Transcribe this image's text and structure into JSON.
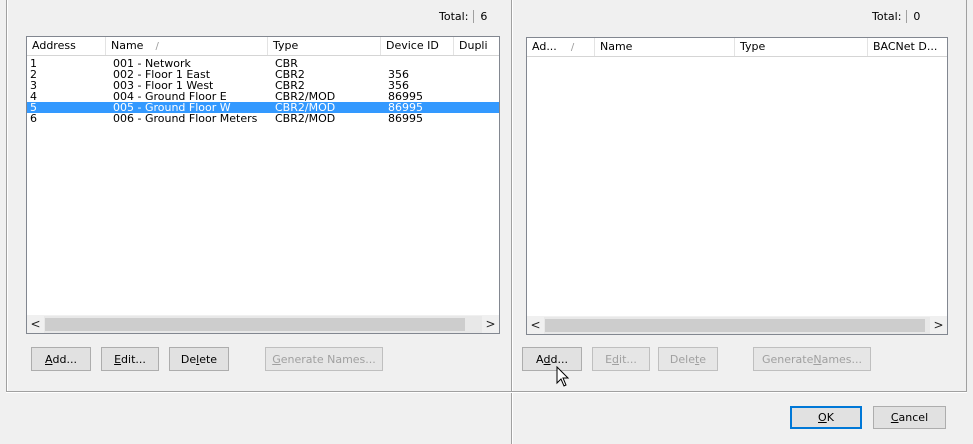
{
  "left_panel": {
    "total_label": "Total:",
    "total_value": "6",
    "columns": [
      "Address",
      "Name",
      "Type",
      "Device ID",
      "Dupli"
    ],
    "sort_glyph": "/",
    "rows": [
      {
        "address": "1",
        "name": "001 - Network",
        "type": "CBR",
        "device_id": "",
        "selected": false
      },
      {
        "address": "2",
        "name": "002 - Floor 1 East",
        "type": "CBR2",
        "device_id": "356",
        "selected": false
      },
      {
        "address": "3",
        "name": "003 - Floor 1 West",
        "type": "CBR2",
        "device_id": "356",
        "selected": false
      },
      {
        "address": "4",
        "name": "004 - Ground Floor E",
        "type": "CBR2/MOD",
        "device_id": "86995",
        "selected": false
      },
      {
        "address": "5",
        "name": "005 - Ground Floor W",
        "type": "CBR2/MOD",
        "device_id": "86995",
        "selected": true
      },
      {
        "address": "6",
        "name": "006 - Ground Floor Meters",
        "type": "CBR2/MOD",
        "device_id": "86995",
        "selected": false
      }
    ],
    "buttons": {
      "add": {
        "pre": "",
        "u": "A",
        "post": "dd..."
      },
      "edit": {
        "pre": "",
        "u": "E",
        "post": "dit..."
      },
      "delete": {
        "pre": "De",
        "u": "l",
        "post": "ete"
      },
      "generate": {
        "pre": "",
        "u": "G",
        "post": "enerate Names..."
      }
    }
  },
  "right_panel": {
    "total_label": "Total:",
    "total_value": "0",
    "columns": [
      "Ad...",
      "Name",
      "Type",
      "BACNet D..."
    ],
    "sort_glyph": "/",
    "buttons": {
      "add": {
        "pre": "A",
        "u": "d",
        "post": "d..."
      },
      "edit": {
        "pre": "E",
        "u": "d",
        "post": "it..."
      },
      "delete": {
        "pre": "Dele",
        "u": "t",
        "post": "e"
      },
      "generate": {
        "pre": "Generate ",
        "u": "N",
        "post": "ames..."
      }
    }
  },
  "dialog": {
    "ok": {
      "pre": "",
      "u": "O",
      "post": "K"
    },
    "cancel": {
      "pre": "",
      "u": "C",
      "post": "ancel"
    }
  },
  "scroll_arrows": {
    "left": "<",
    "right": ">"
  },
  "colors": {
    "selection": "#3399ff",
    "button_face": "#e1e1e1",
    "default_border": "#0078d7"
  },
  "icons": [
    "chevron-left-icon",
    "chevron-right-icon",
    "mouse-pointer-icon"
  ]
}
